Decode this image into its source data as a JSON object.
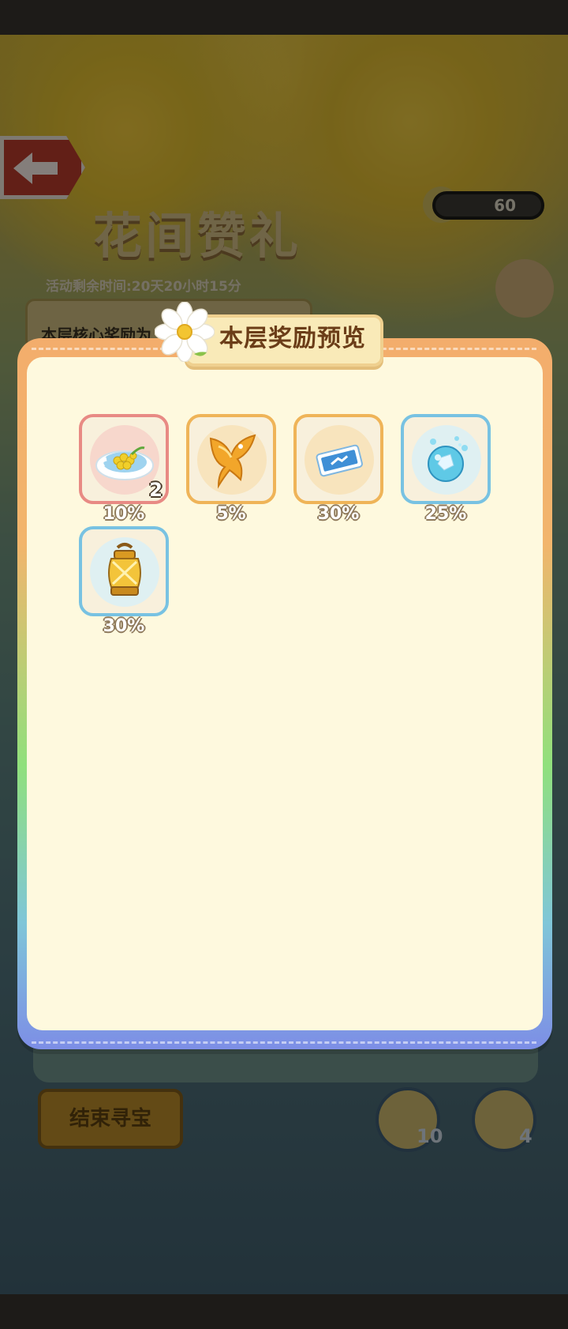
{
  "background": {
    "back_button_icon": "arrow-left-icon",
    "coin_count": "60",
    "game_title": "花间赞礼",
    "timer_text": "活动剩余时间:20天20小时15分",
    "core_reward_text": "本层核心奖励为",
    "end_button_label": "结束寻宝",
    "tools": [
      {
        "icon": "sun-tool-icon",
        "count": "10"
      },
      {
        "icon": "lion-tool-icon",
        "count": "4"
      }
    ]
  },
  "modal": {
    "title": "本层奖励预览",
    "items": [
      {
        "icon": "flower-bouquet-icon",
        "count": "2",
        "percent": "10%",
        "rarity": "red"
      },
      {
        "icon": "golden-bird-icon",
        "count": "",
        "percent": "5%",
        "rarity": "orange"
      },
      {
        "icon": "ticket-icon",
        "count": "",
        "percent": "30%",
        "rarity": "orange"
      },
      {
        "icon": "crystal-orb-icon",
        "count": "",
        "percent": "25%",
        "rarity": "blue"
      },
      {
        "icon": "lantern-icon",
        "count": "",
        "percent": "30%",
        "rarity": "blue"
      }
    ]
  },
  "colors": {
    "rarity_red": "#e88a84",
    "rarity_orange": "#efb458",
    "rarity_blue": "#78c2e2",
    "panel_bg": "#fef9de"
  }
}
